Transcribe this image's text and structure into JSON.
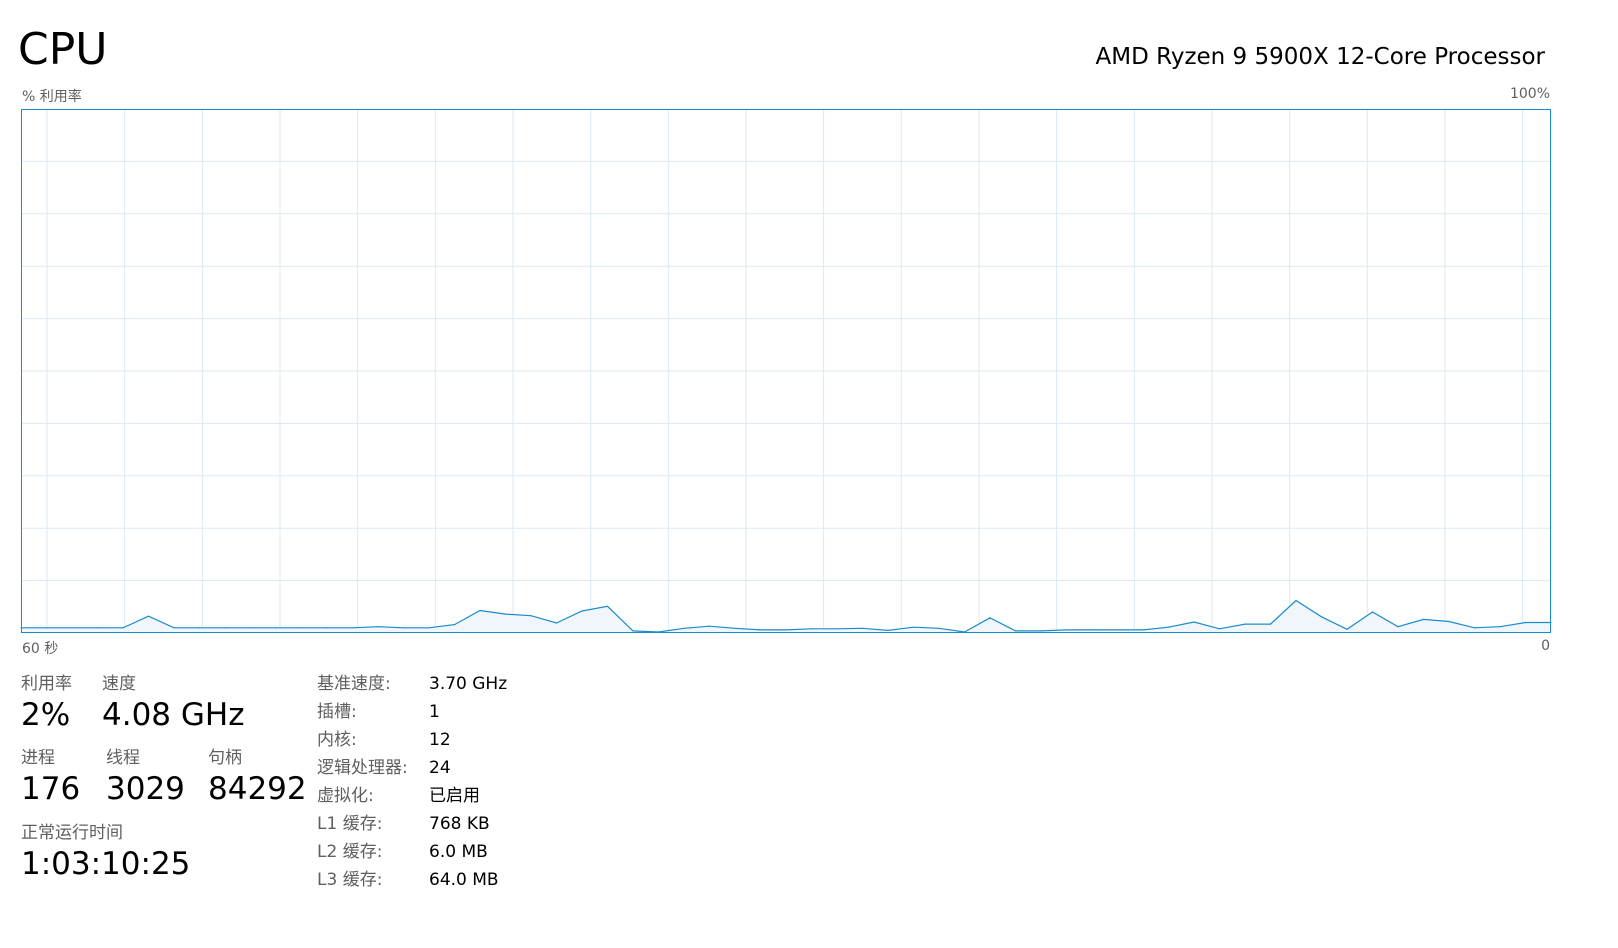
{
  "header": {
    "title": "CPU",
    "processor_name": "AMD Ryzen 9 5900X 12-Core Processor"
  },
  "graph": {
    "y_label": "% 利用率",
    "y_max_label": "100%",
    "x_left_label": "60 秒",
    "x_right_label": "0",
    "line_color": "#1a8ccb",
    "fill_color": "#f0f6fb",
    "grid_color": "#d9eaf4",
    "border_color": "#1a8ccb"
  },
  "chart_data": {
    "type": "area",
    "xlabel": "",
    "ylabel": "% 利用率",
    "ylim": [
      0,
      100
    ],
    "xlim": [
      60,
      0
    ],
    "grid": true,
    "x": [
      60,
      59,
      58,
      57,
      56,
      55,
      54,
      53,
      52,
      51,
      50,
      49,
      48,
      47,
      46,
      45,
      44,
      43,
      42,
      41,
      40,
      39,
      38,
      37,
      36,
      35,
      34,
      33,
      32,
      31,
      30,
      29,
      28,
      27,
      26,
      25,
      24,
      23,
      22,
      21,
      20,
      19,
      18,
      17,
      16,
      15,
      14,
      13,
      12,
      11,
      10,
      9,
      8,
      7,
      6,
      5,
      4,
      3,
      2,
      1,
      0
    ],
    "values": [
      1.0,
      1.0,
      1.0,
      1.0,
      1.0,
      3.2,
      1.0,
      1.0,
      1.0,
      1.0,
      1.0,
      1.0,
      1.0,
      1.0,
      1.2,
      1.0,
      1.0,
      1.6,
      4.3,
      3.6,
      3.3,
      1.9,
      4.2,
      5.1,
      0.4,
      0.2,
      0.9,
      1.3,
      0.9,
      0.6,
      0.6,
      0.8,
      0.8,
      0.9,
      0.5,
      1.1,
      0.9,
      0.2,
      2.9,
      0.4,
      0.4,
      0.6,
      0.6,
      0.6,
      0.6,
      1.1,
      2.1,
      0.8,
      1.7,
      1.7,
      6.2,
      3.1,
      0.7,
      4.0,
      1.2,
      2.6,
      2.2,
      1.0,
      1.2,
      2.0,
      2.0
    ]
  },
  "stats": {
    "utilization": {
      "label": "利用率",
      "value": "2%"
    },
    "speed": {
      "label": "速度",
      "value": "4.08 GHz"
    },
    "processes": {
      "label": "进程",
      "value": "176"
    },
    "threads": {
      "label": "线程",
      "value": "3029"
    },
    "handles": {
      "label": "句柄",
      "value": "84292"
    },
    "uptime": {
      "label": "正常运行时间",
      "value": "1:03:10:25"
    }
  },
  "specs": [
    {
      "label": "基准速度:",
      "value": "3.70 GHz"
    },
    {
      "label": "插槽:",
      "value": "1"
    },
    {
      "label": "内核:",
      "value": "12"
    },
    {
      "label": "逻辑处理器:",
      "value": "24"
    },
    {
      "label": "虚拟化:",
      "value": "已启用"
    },
    {
      "label": "L1 缓存:",
      "value": "768 KB"
    },
    {
      "label": "L2 缓存:",
      "value": "6.0 MB"
    },
    {
      "label": "L3 缓存:",
      "value": "64.0 MB"
    }
  ]
}
